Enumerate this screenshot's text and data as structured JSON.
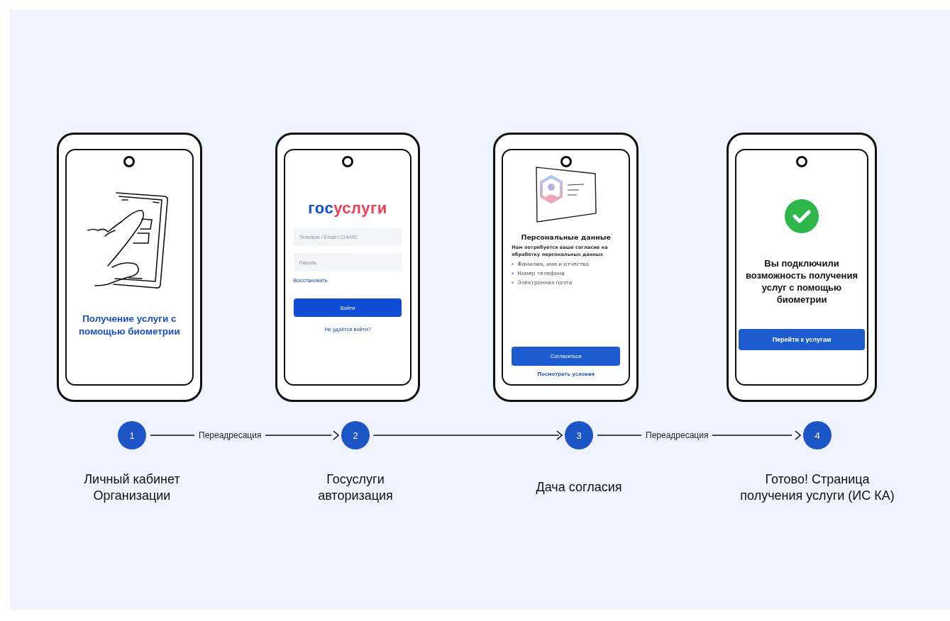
{
  "screens": [
    {
      "kind": "intro",
      "title": "Получение услуги с помощью биометрии"
    },
    {
      "kind": "login",
      "logo": {
        "part_1": "гос",
        "part_2": "услуги"
      },
      "fields": [
        {
          "placeholder": "Телефон / Email / СНИЛС"
        },
        {
          "placeholder": "Пароль"
        }
      ],
      "restore_link": "Восстановить",
      "button": "Войти",
      "help_link": "Не удаётся войти?"
    },
    {
      "kind": "consent",
      "title": "Персональные данные",
      "text": "Нам потребуется ваше согласие на обработку персональных данных",
      "items": [
        "Фамилия, имя и отчество",
        "Номер телефона",
        "Электронная почта"
      ],
      "button": "Согласиться",
      "link": "Посмотреть условия"
    },
    {
      "kind": "done",
      "title": "Вы подключили возможность получения услуг с помощью биометрии",
      "button": "Перейти к услугам"
    }
  ],
  "steps": [
    {
      "number": "1",
      "label": "Личный кабинет\nОрганизации"
    },
    {
      "number": "2",
      "label": "Госуслуги\nавторизация"
    },
    {
      "number": "3",
      "label": "Дача согласия"
    },
    {
      "number": "4",
      "label": "Готово! Страница\nполучения услуги (ИС КА)"
    }
  ],
  "connectors": [
    {
      "kind": "labeled",
      "label": "Переадресация"
    },
    {
      "kind": "plain"
    },
    {
      "kind": "labeled",
      "label": "Переадресация"
    }
  ]
}
